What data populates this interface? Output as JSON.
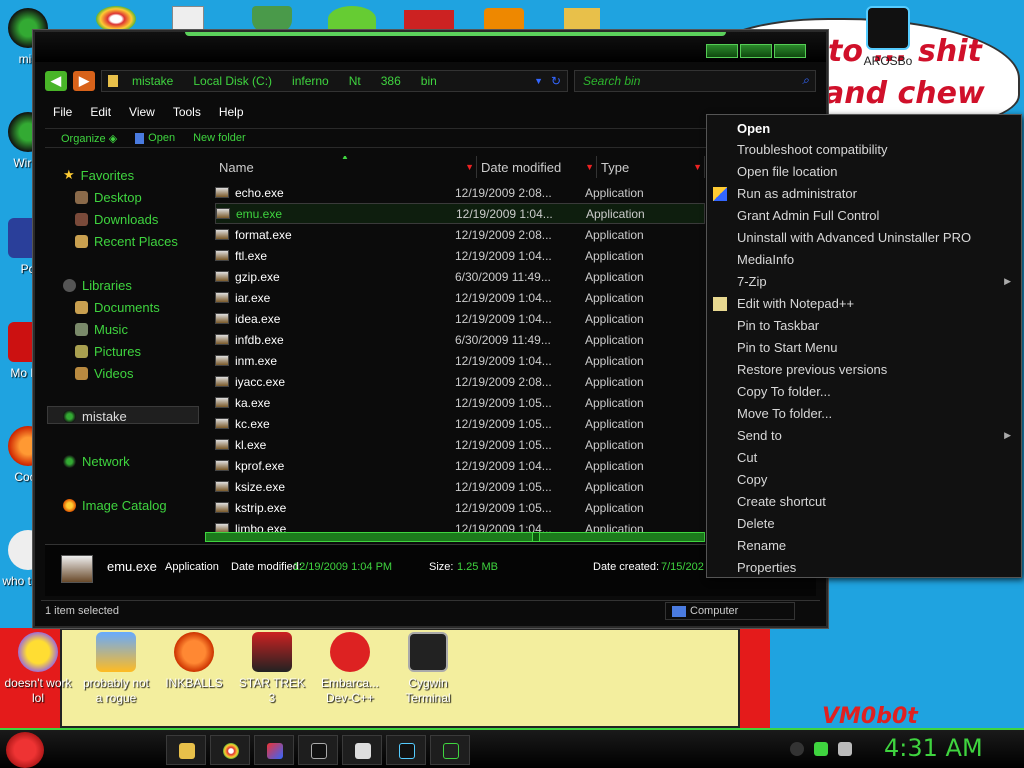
{
  "desktop": {
    "left_icons": [
      {
        "label": "mis"
      },
      {
        "label": "Wir V"
      },
      {
        "label": "Po"
      },
      {
        "label": "Mo Re"
      },
      {
        "label": "Cock"
      },
      {
        "label": "who t use"
      }
    ],
    "bottom_icons": [
      {
        "label": "doesn't work lol"
      },
      {
        "label": "probably not a rogue"
      },
      {
        "label": "INKBALLS"
      },
      {
        "label": "STAR TREK 3"
      },
      {
        "label": "Embarca... Dev-C++"
      },
      {
        "label": "Cygwin Terminal"
      }
    ],
    "top_right_icon": {
      "label": "AROSBo"
    },
    "wallpaper_text_1": "to ... shit",
    "wallpaper_text_2": "and chew",
    "wallpaper_tag": "VM0b0t"
  },
  "explorer": {
    "breadcrumb": [
      "mistake",
      "Local Disk (C:)",
      "inferno",
      "Nt",
      "386",
      "bin"
    ],
    "search_placeholder": "Search bin",
    "menu": [
      "File",
      "Edit",
      "View",
      "Tools",
      "Help"
    ],
    "commands": [
      "Organize",
      "Open",
      "New folder"
    ],
    "nav": {
      "favorites": "Favorites",
      "favorites_items": [
        "Desktop",
        "Downloads",
        "Recent Places"
      ],
      "libraries": "Libraries",
      "libraries_items": [
        "Documents",
        "Music",
        "Pictures",
        "Videos"
      ],
      "homegroup": "mistake",
      "network": "Network",
      "image_catalog": "Image Catalog"
    },
    "columns": {
      "name": "Name",
      "date": "Date modified",
      "type": "Type"
    },
    "files": [
      {
        "name": "echo.exe",
        "date": "12/19/2009 2:08...",
        "type": "Application"
      },
      {
        "name": "emu.exe",
        "date": "12/19/2009 1:04...",
        "type": "Application"
      },
      {
        "name": "format.exe",
        "date": "12/19/2009 2:08...",
        "type": "Application"
      },
      {
        "name": "ftl.exe",
        "date": "12/19/2009 1:04...",
        "type": "Application"
      },
      {
        "name": "gzip.exe",
        "date": "6/30/2009 11:49...",
        "type": "Application"
      },
      {
        "name": "iar.exe",
        "date": "12/19/2009 1:04...",
        "type": "Application"
      },
      {
        "name": "idea.exe",
        "date": "12/19/2009 1:04...",
        "type": "Application"
      },
      {
        "name": "infdb.exe",
        "date": "6/30/2009 11:49...",
        "type": "Application"
      },
      {
        "name": "inm.exe",
        "date": "12/19/2009 1:04...",
        "type": "Application"
      },
      {
        "name": "iyacc.exe",
        "date": "12/19/2009 2:08...",
        "type": "Application"
      },
      {
        "name": "ka.exe",
        "date": "12/19/2009 1:05...",
        "type": "Application"
      },
      {
        "name": "kc.exe",
        "date": "12/19/2009 1:05...",
        "type": "Application"
      },
      {
        "name": "kl.exe",
        "date": "12/19/2009 1:05...",
        "type": "Application"
      },
      {
        "name": "kprof.exe",
        "date": "12/19/2009 1:04...",
        "type": "Application"
      },
      {
        "name": "ksize.exe",
        "date": "12/19/2009 1:05...",
        "type": "Application"
      },
      {
        "name": "kstrip.exe",
        "date": "12/19/2009 1:05...",
        "type": "Application"
      },
      {
        "name": "limbo.exe",
        "date": "12/19/2009 1:04...",
        "type": "Application"
      }
    ],
    "selected_index": 1,
    "details": {
      "name": "emu.exe",
      "kind": "Application",
      "date_modified_label": "Date modified:",
      "date_modified": "12/19/2009 1:04 PM",
      "size_label": "Size:",
      "size": "1.25 MB",
      "date_created_label": "Date created:",
      "date_created": "7/15/202"
    },
    "status_text": "1 item selected",
    "status_location": "Computer"
  },
  "context_menu": [
    {
      "label": "Open",
      "bold": true
    },
    {
      "label": "Troubleshoot compatibility"
    },
    {
      "label": "Open file location"
    },
    {
      "label": "Run as administrator",
      "icon": "shield-icon"
    },
    {
      "label": "Grant Admin Full Control"
    },
    {
      "label": "Uninstall with Advanced Uninstaller PRO"
    },
    {
      "label": "MediaInfo"
    },
    {
      "label": "7-Zip",
      "submenu": true
    },
    {
      "label": "Edit with Notepad++",
      "icon": "notepad-icon"
    },
    {
      "label": "Pin to Taskbar"
    },
    {
      "label": "Pin to Start Menu"
    },
    {
      "label": "Restore previous versions"
    },
    {
      "label": "Copy To folder..."
    },
    {
      "label": "Move To folder..."
    },
    {
      "label": "Send to",
      "submenu": true
    },
    {
      "label": "Cut"
    },
    {
      "label": "Copy"
    },
    {
      "label": "Create shortcut"
    },
    {
      "label": "Delete"
    },
    {
      "label": "Rename"
    },
    {
      "label": "Properties"
    }
  ],
  "taskbar": {
    "clock": "4:31 AM"
  },
  "colors": {
    "accent_green": "#3fd43f",
    "desktop_blue": "#1fa3e0"
  }
}
